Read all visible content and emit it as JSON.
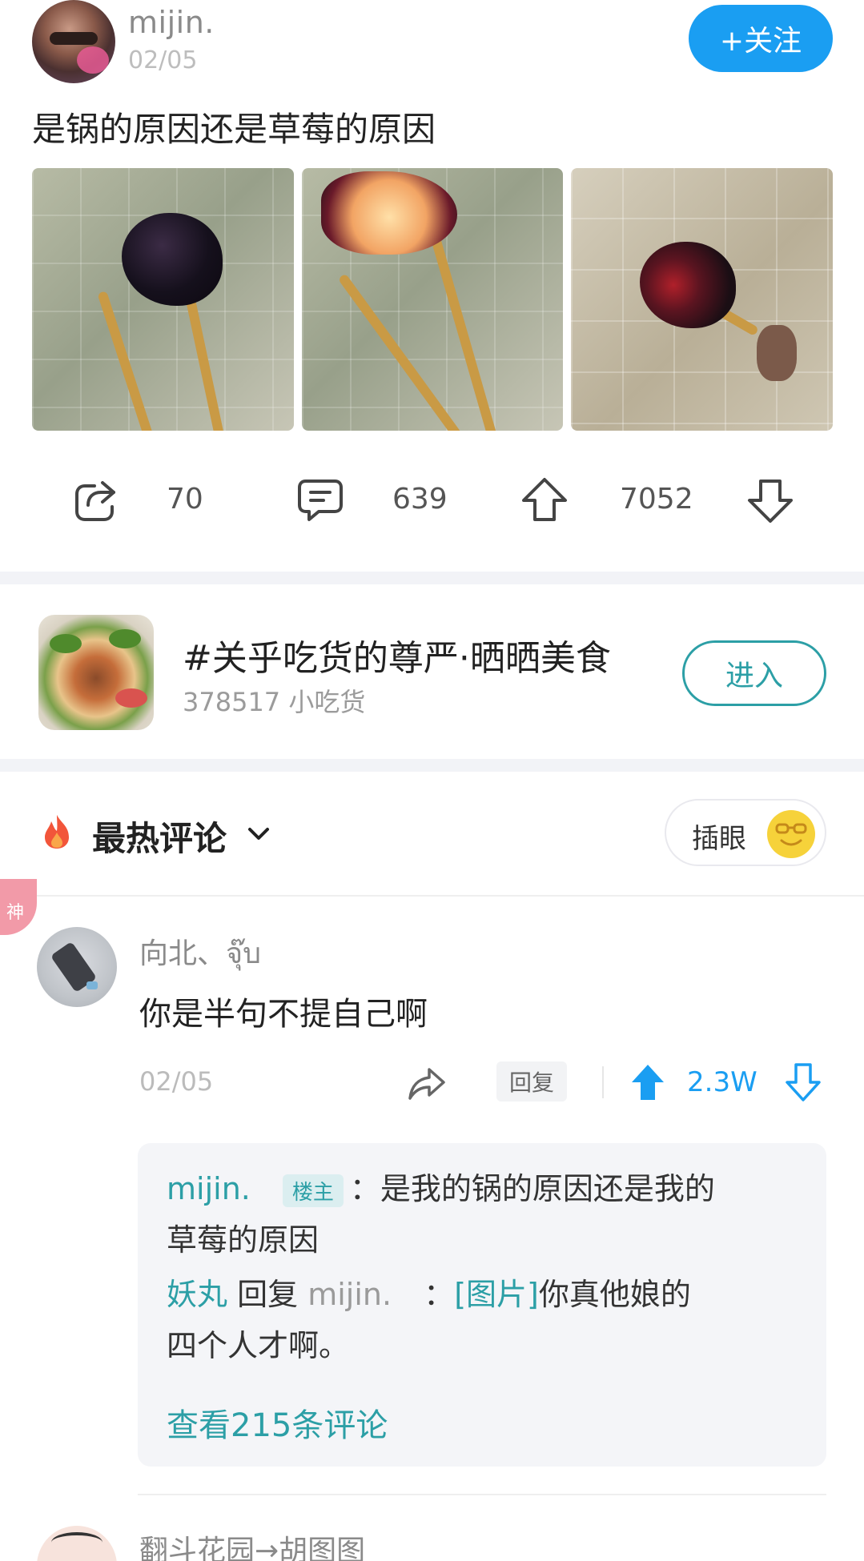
{
  "post": {
    "author": "mijin.",
    "date": "02/05",
    "follow_label": "+关注",
    "text": "是锅的原因还是草莓的原因"
  },
  "actions": {
    "share_count": "70",
    "comment_count": "639",
    "upvote_count": "7052"
  },
  "topic": {
    "title": "#关乎吃货的尊严·晒晒美食",
    "subtitle": "378517 小吃货",
    "enter_label": "进入"
  },
  "comments_header": {
    "title": "最热评论",
    "insert_label": "插眼"
  },
  "comment": {
    "badge": "神",
    "author": "向北、จุ๊บ",
    "text": "你是半句不提自己啊",
    "date": "02/05",
    "reply_label": "回复",
    "votes": "2.3W",
    "replies": {
      "r1_name": "mijin.",
      "r1_badge": "楼主",
      "r1_text_a": "：是我的锅的原因还是我的",
      "r1_text_b": "草莓的原因",
      "r2_name": "妖丸",
      "r2_reply_word": "回复",
      "r2_target": "mijin.",
      "r2_colon": "：",
      "r2_image_tag": "[图片]",
      "r2_text_a": "你真他娘的",
      "r2_text_b": "四个人才啊。",
      "view_more": "查看215条评论"
    }
  },
  "next_comment": {
    "author": "翻斗花园→胡图图"
  },
  "colors": {
    "accent_blue": "#1a9ef2",
    "teal": "#2c9fa6",
    "god_badge": "#f29aa8"
  }
}
